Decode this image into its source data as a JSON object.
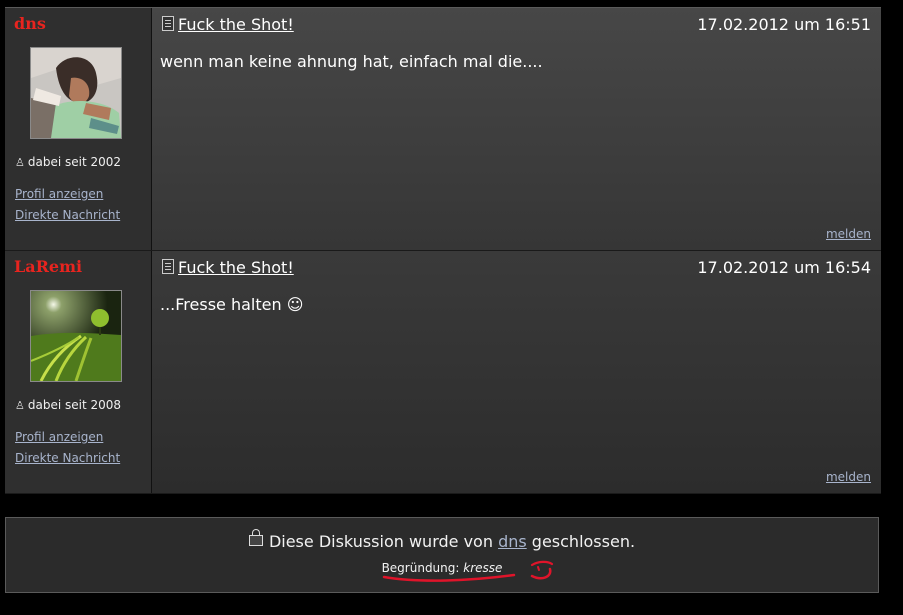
{
  "posts": [
    {
      "username": "dns",
      "member_since": "dabei seit 2002",
      "profile_link": "Profil anzeigen",
      "message_link": "Direkte Nachricht",
      "title": "Fuck the Shot!",
      "date": "17.02.2012 um 16:51",
      "body": "wenn man keine ahnung hat, einfach mal die....",
      "report": "melden"
    },
    {
      "username": "LaRemi",
      "member_since": "dabei seit 2008",
      "profile_link": "Profil anzeigen",
      "message_link": "Direkte Nachricht",
      "title": "Fuck the Shot!",
      "date": "17.02.2012 um 16:54",
      "body": "...Fresse halten ☺",
      "report": "melden"
    }
  ],
  "closed": {
    "prefix": "Diese Diskussion wurde von",
    "user": "dns",
    "suffix": "geschlossen.",
    "reason_label": "Begründung:",
    "reason": "kresse"
  },
  "colors": {
    "username": "#e8241f",
    "link": "#a8b4cc",
    "annotation": "#e0142a"
  },
  "icons": [
    "document-icon",
    "member-icon",
    "lock-icon"
  ]
}
